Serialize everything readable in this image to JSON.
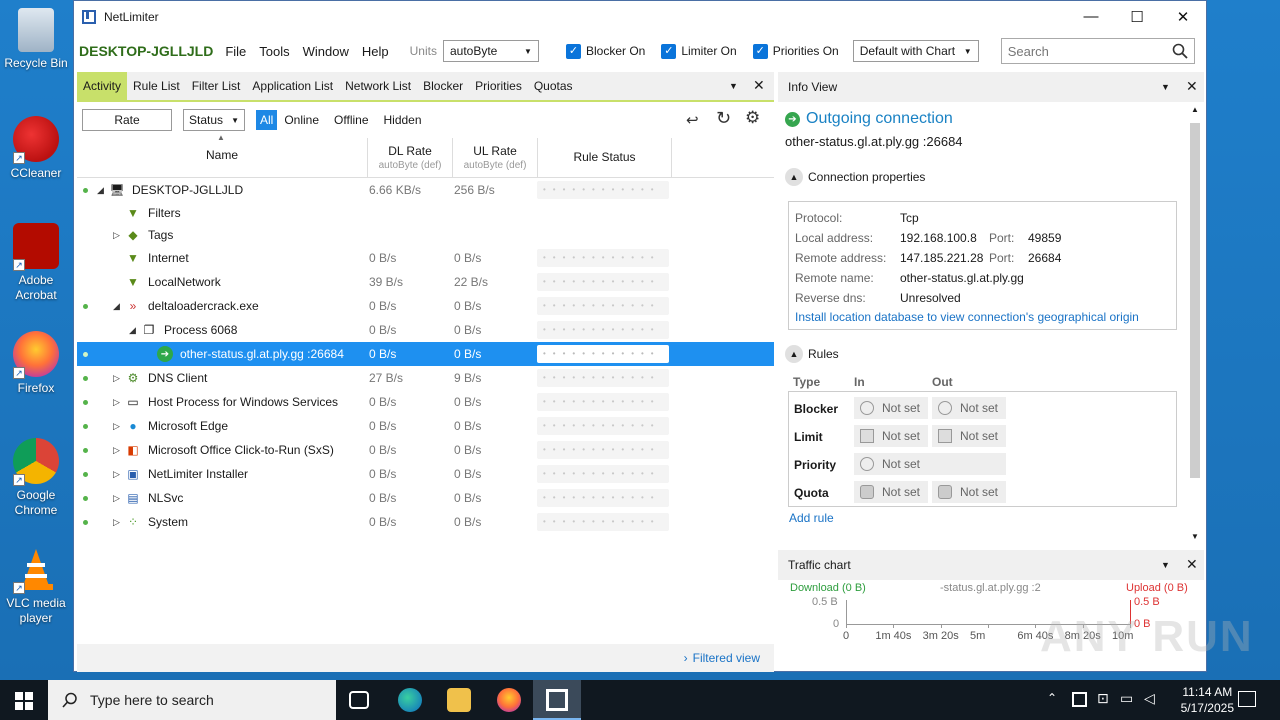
{
  "desktop": {
    "icons": [
      {
        "label": "Recycle Bin",
        "name": "recycle-bin-icon"
      },
      {
        "label": "CCleaner",
        "name": "ccleaner-icon"
      },
      {
        "label": "Adobe Acrobat",
        "name": "adobe-acrobat-icon"
      },
      {
        "label": "Firefox",
        "name": "firefox-icon"
      },
      {
        "label": "Google Chrome",
        "name": "google-chrome-icon"
      },
      {
        "label": "VLC media player",
        "name": "vlc-icon"
      }
    ]
  },
  "window": {
    "title": "NetLimiter",
    "minimize": "—",
    "maximize": "☐",
    "close": "✕"
  },
  "menubar": {
    "host": "DESKTOP-JGLLJLD",
    "items": [
      "File",
      "Tools",
      "Window",
      "Help"
    ],
    "units_label": "Units",
    "units_value": "autoByte",
    "blocker_label": "Blocker On",
    "limiter_label": "Limiter On",
    "priorities_label": "Priorities On",
    "chart_mode": "Default with Chart",
    "search_placeholder": "Search"
  },
  "tabs": {
    "items": [
      "Activity",
      "Rule List",
      "Filter List",
      "Application List",
      "Network List",
      "Blocker",
      "Priorities",
      "Quotas"
    ],
    "active": "Activity"
  },
  "filterbar": {
    "rate": "Rate",
    "status": "Status",
    "segments": [
      "All",
      "Online",
      "Offline",
      "Hidden"
    ],
    "active_segment": "All"
  },
  "columns": {
    "name": "Name",
    "dl": "DL Rate",
    "dl_sub": "autoByte (def)",
    "ul": "UL Rate",
    "ul_sub": "autoByte (def)",
    "rule_status": "Rule Status"
  },
  "rows": [
    {
      "name": "DESKTOP-JGLLJLD",
      "dl": "6.66 KB/s",
      "ul": "256 B/s",
      "indent": 0,
      "expander": "◢",
      "icon": "computer-icon",
      "glyph": "🖥",
      "dot": true,
      "rs": true
    },
    {
      "name": "Filters",
      "dl": "",
      "ul": "",
      "indent": 1,
      "expander": "",
      "icon": "filter-icon",
      "glyph": "▼",
      "dot": false,
      "rs": false
    },
    {
      "name": "Tags",
      "dl": "",
      "ul": "",
      "indent": 1,
      "expander": "▷",
      "icon": "tags-icon",
      "glyph": "◆",
      "dot": false,
      "rs": false
    },
    {
      "name": "Internet",
      "dl": "0 B/s",
      "ul": "0 B/s",
      "indent": 1,
      "expander": "",
      "icon": "filter-icon",
      "glyph": "▼",
      "dot": false,
      "rs": true
    },
    {
      "name": "LocalNetwork",
      "dl": "39 B/s",
      "ul": "22 B/s",
      "indent": 1,
      "expander": "",
      "icon": "filter-icon",
      "glyph": "▼",
      "dot": false,
      "rs": true
    },
    {
      "name": "deltaloadercrack.exe",
      "dl": "0 B/s",
      "ul": "0 B/s",
      "indent": 1,
      "expander": "◢",
      "icon": "app-icon",
      "glyph": "»",
      "dot": true,
      "rs": true
    },
    {
      "name": "Process 6068",
      "dl": "0 B/s",
      "ul": "0 B/s",
      "indent": 2,
      "expander": "◢",
      "icon": "process-icon",
      "glyph": "❐",
      "dot": false,
      "rs": true
    },
    {
      "name": "other-status.gl.at.ply.gg :26684",
      "dl": "0 B/s",
      "ul": "0 B/s",
      "indent": 3,
      "expander": "",
      "icon": "outgoing-connection-icon",
      "glyph": "➔",
      "dot": true,
      "rs": true,
      "selected": true
    },
    {
      "name": "DNS Client",
      "dl": "27 B/s",
      "ul": "9 B/s",
      "indent": 1,
      "expander": "▷",
      "icon": "gear-icon",
      "glyph": "⚙",
      "dot": true,
      "rs": true
    },
    {
      "name": "Host Process for Windows Services",
      "dl": "0 B/s",
      "ul": "0 B/s",
      "indent": 1,
      "expander": "▷",
      "icon": "window-icon",
      "glyph": "▭",
      "dot": true,
      "rs": true
    },
    {
      "name": "Microsoft Edge",
      "dl": "0 B/s",
      "ul": "0 B/s",
      "indent": 1,
      "expander": "▷",
      "icon": "edge-icon",
      "glyph": "●",
      "dot": true,
      "rs": true
    },
    {
      "name": "Microsoft Office Click-to-Run (SxS)",
      "dl": "0 B/s",
      "ul": "0 B/s",
      "indent": 1,
      "expander": "▷",
      "icon": "office-icon",
      "glyph": "◧",
      "dot": true,
      "rs": true
    },
    {
      "name": "NetLimiter Installer",
      "dl": "0 B/s",
      "ul": "0 B/s",
      "indent": 1,
      "expander": "▷",
      "icon": "netlimiter-icon",
      "glyph": "▣",
      "dot": true,
      "rs": true
    },
    {
      "name": "NLSvc",
      "dl": "0 B/s",
      "ul": "0 B/s",
      "indent": 1,
      "expander": "▷",
      "icon": "service-icon",
      "glyph": "▤",
      "dot": true,
      "rs": true
    },
    {
      "name": "System",
      "dl": "0 B/s",
      "ul": "0 B/s",
      "indent": 1,
      "expander": "▷",
      "icon": "system-icon",
      "glyph": "⁘",
      "dot": true,
      "rs": true
    }
  ],
  "filtered_view": "Filtered view",
  "info": {
    "header": "Info View",
    "title": "Outgoing connection",
    "host": "other-status.gl.at.ply.gg :26684",
    "conn_props_label": "Connection properties",
    "props": {
      "protocol_k": "Protocol:",
      "protocol_v": "Tcp",
      "local_k": "Local address:",
      "local_v": "192.168.100.8",
      "local_port_k": "Port:",
      "local_port_v": "49859",
      "remote_k": "Remote address:",
      "remote_v": "147.185.221.28",
      "remote_port_k": "Port:",
      "remote_port_v": "26684",
      "rname_k": "Remote name:",
      "rname_v": "other-status.gl.at.ply.gg",
      "rdns_k": "Reverse dns:",
      "rdns_v": "Unresolved",
      "install_link": "Install location database to view connection's geographical origin"
    },
    "rules_label": "Rules",
    "rules_cols": {
      "type": "Type",
      "in": "In",
      "out": "Out"
    },
    "rules": {
      "blocker": "Blocker",
      "limit": "Limit",
      "priority": "Priority",
      "quota": "Quota",
      "not_set": "Not set"
    },
    "add_rule": "Add rule"
  },
  "traffic": {
    "header": "Traffic chart",
    "download": "Download (0 B)",
    "host": "-status.gl.at.ply.gg :2",
    "upload": "Upload (0 B)",
    "y_top": "0.5 B",
    "y_zero": "0",
    "y_top_right": "0.5 B",
    "y_zero_right": "0 B",
    "x_ticks": [
      "0",
      "1m 40s",
      "3m 20s",
      "5m",
      "6m 40s",
      "8m 20s",
      "10m"
    ]
  },
  "taskbar": {
    "search_placeholder": "Type here to search",
    "time": "11:14 AM",
    "date": "5/17/2025"
  },
  "watermark": "ANY RUN"
}
